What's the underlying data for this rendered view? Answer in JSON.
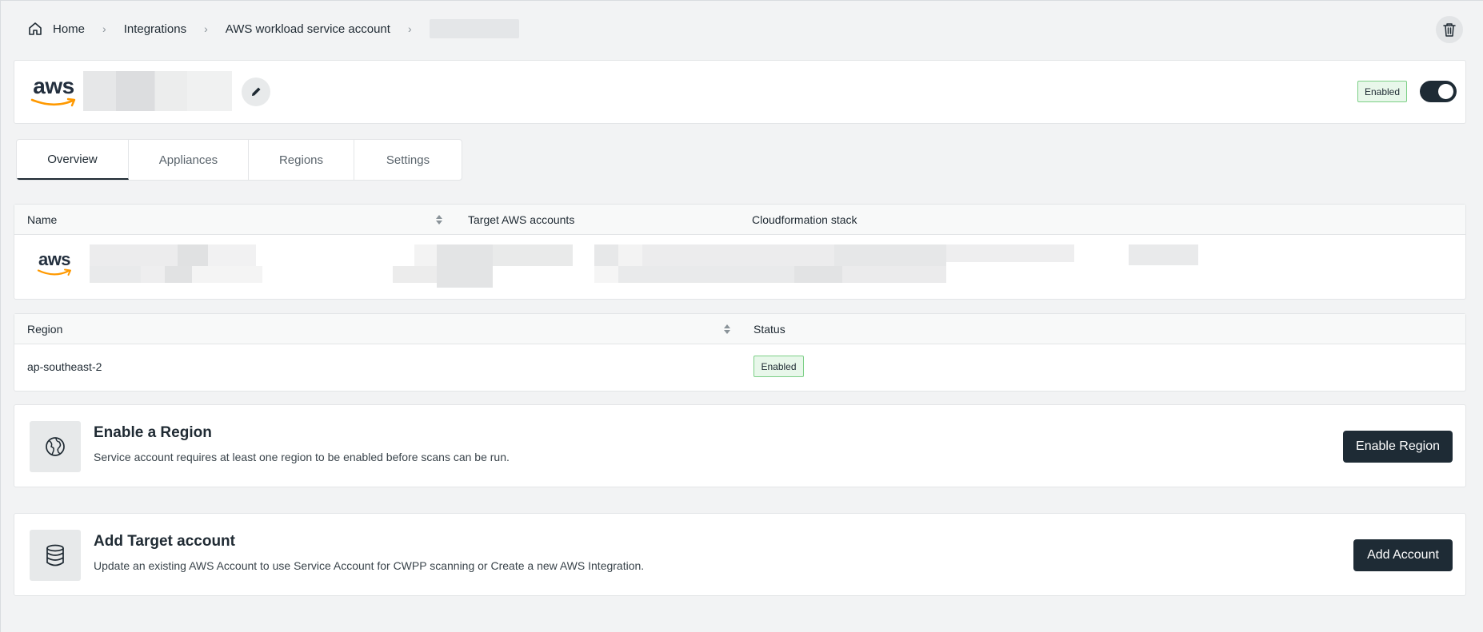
{
  "breadcrumb": {
    "home": "Home",
    "items": [
      "Integrations",
      "AWS workload service account"
    ],
    "separator": "›"
  },
  "header": {
    "logo_text": "aws",
    "status_badge": "Enabled",
    "toggle_on": true
  },
  "tabs": [
    {
      "label": "Overview",
      "active": true
    },
    {
      "label": "Appliances",
      "active": false
    },
    {
      "label": "Regions",
      "active": false
    },
    {
      "label": "Settings",
      "active": false
    }
  ],
  "accounts_table": {
    "columns": [
      "Name",
      "Target AWS accounts",
      "Cloudformation stack"
    ],
    "row_logo_text": "aws"
  },
  "regions_table": {
    "columns": [
      "Region",
      "Status"
    ],
    "rows": [
      {
        "region": "ap-southeast-2",
        "status": "Enabled"
      }
    ]
  },
  "enable_region": {
    "title": "Enable a Region",
    "description": "Service account requires at least one region to be enabled before scans can be run.",
    "button": "Enable Region"
  },
  "add_target": {
    "title": "Add Target account",
    "description": "Update an existing AWS Account to use Service Account for CWPP scanning or Create a new AWS Integration.",
    "button": "Add Account"
  },
  "colors": {
    "page_bg": "#f2f3f4",
    "dark_button": "#1e2b35",
    "aws_orange": "#ff9900",
    "enabled_border": "#7ccf86",
    "enabled_bg": "#e8f7ea"
  }
}
